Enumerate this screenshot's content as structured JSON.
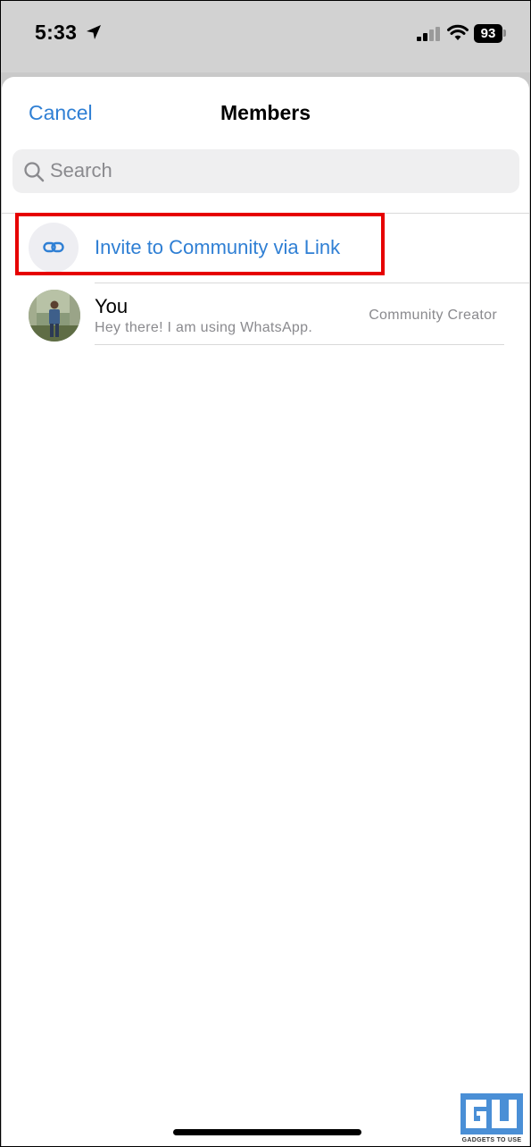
{
  "status_bar": {
    "time": "5:33",
    "battery": "93",
    "icons": [
      "location-arrow-icon",
      "cellular-signal-icon",
      "wifi-icon",
      "battery-icon"
    ]
  },
  "header": {
    "cancel_label": "Cancel",
    "title": "Members"
  },
  "search": {
    "placeholder": "Search"
  },
  "invite": {
    "label": "Invite to Community via Link",
    "icon": "link-icon",
    "highlight_color": "#e60000"
  },
  "members": [
    {
      "name": "You",
      "status": "Hey there! I am using WhatsApp.",
      "role": "Community Creator"
    }
  ],
  "watermark": {
    "caption": "GADGETS TO USE"
  },
  "colors": {
    "accent": "#2f7fd4",
    "secondary_text": "#8a8a8e"
  }
}
